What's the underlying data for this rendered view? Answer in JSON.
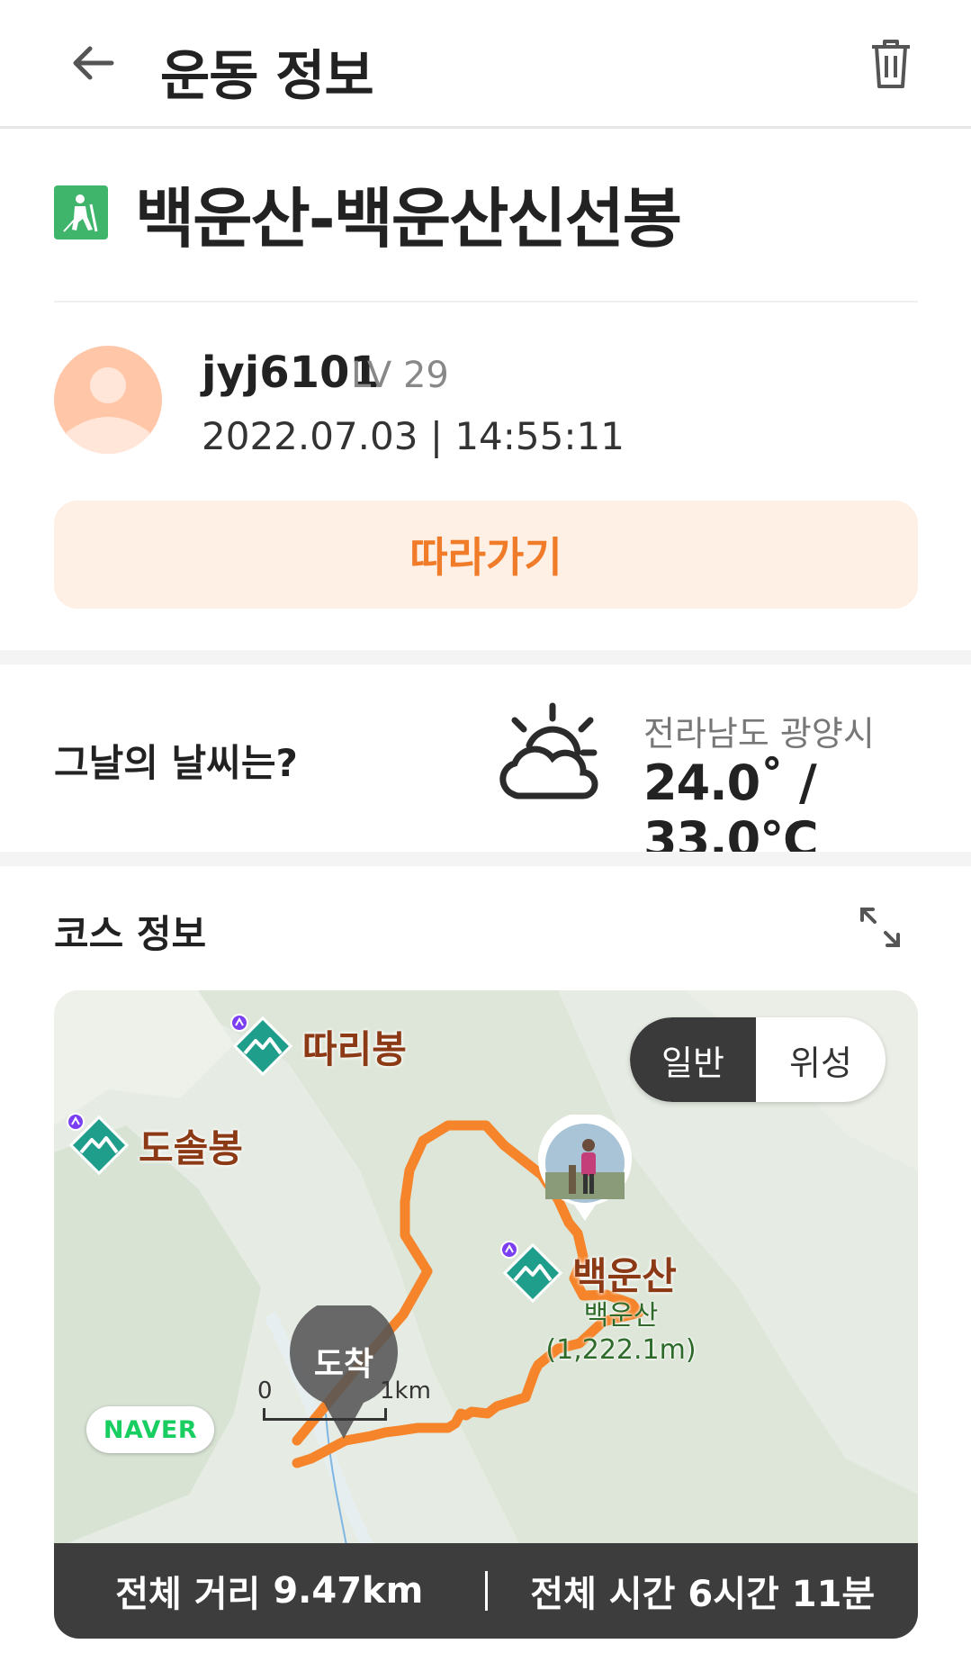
{
  "header": {
    "title": "운동 정보"
  },
  "route": {
    "title": "백운산-백운산신선봉"
  },
  "user": {
    "username": "jyj6101",
    "level": "LV 29",
    "datetime": "2022.07.03 | 14:55:11"
  },
  "follow_button": {
    "label": "따라가기"
  },
  "weather": {
    "question": "그날의 날씨는?",
    "location": "전라남도 광양시",
    "temperature": "24.0˚ / 33.0℃",
    "icon": "partly-cloudy-icon"
  },
  "course": {
    "title": "코스 정보",
    "map": {
      "toggle": {
        "general": "일반",
        "satellite": "위성",
        "selected": "일반"
      },
      "peaks": [
        {
          "name": "따리봉"
        },
        {
          "name": "도솔봉"
        },
        {
          "name": "백운산",
          "sub_name": "백운산",
          "elevation": "(1,222.1m)"
        }
      ],
      "arrival_label": "도착",
      "provider": "NAVER",
      "scale": {
        "start": "0",
        "end": "1km"
      }
    },
    "stats": {
      "distance_label": "전체 거리",
      "distance_value": "9.47km",
      "time_label": "전체 시간",
      "time_value": "6시간 11분"
    }
  },
  "colors": {
    "accent": "#f07c2a",
    "route": "#f5842a",
    "peak_marker": "#1f9e8c",
    "stats_bar": "#3d3d3d"
  }
}
